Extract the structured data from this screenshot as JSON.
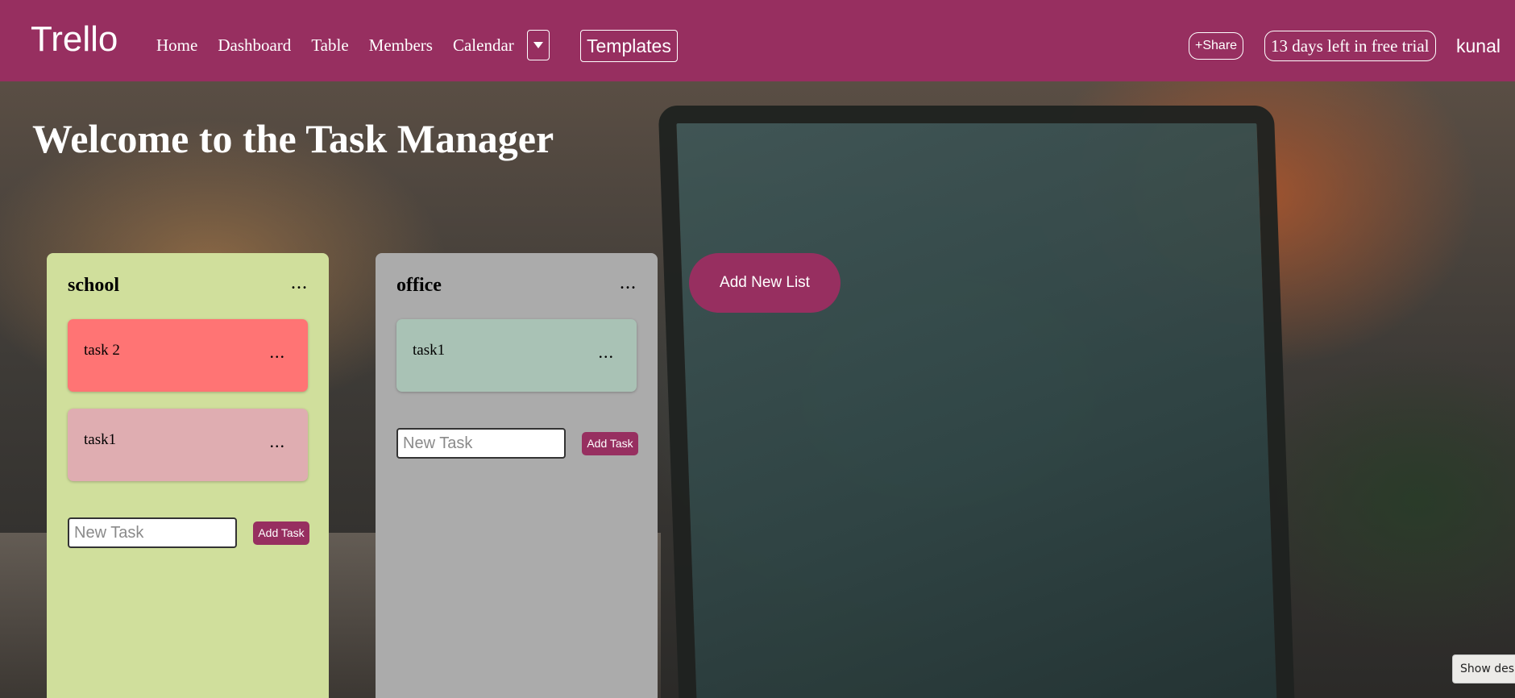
{
  "navbar": {
    "brand": "Trello",
    "links": [
      "Home",
      "Dashboard",
      "Table",
      "Members",
      "Calendar"
    ],
    "templates_label": "Templates",
    "share_label": "+Share",
    "trial_label": "13 days left in free trial",
    "user_name": "kunal",
    "color": "#972f60"
  },
  "main": {
    "title": "Welcome to the Task Manager",
    "add_list_label": "Add New List",
    "lists": [
      {
        "title": "school",
        "menu": "...",
        "color": "#d0df9c",
        "tasks": [
          {
            "label": "task 2",
            "menu": "...",
            "color": "#ff7474"
          },
          {
            "label": "task1",
            "menu": "...",
            "color": "#dfadb1"
          }
        ],
        "input_placeholder": "New Task",
        "add_button_label": "Add Task"
      },
      {
        "title": "office",
        "menu": "...",
        "color": "#ababab",
        "tasks": [
          {
            "label": "task1",
            "menu": "...",
            "color": "#a9c2b5"
          }
        ],
        "input_placeholder": "New Task",
        "add_button_label": "Add Task"
      }
    ]
  },
  "tooltip": {
    "show_desktop": "Show desktop"
  }
}
